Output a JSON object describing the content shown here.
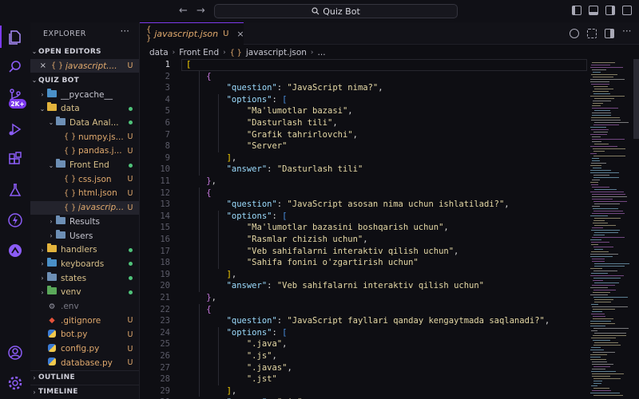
{
  "titlebar": {
    "search_text": "Quiz Bot"
  },
  "activity": {
    "badge": "2K+"
  },
  "sidebar": {
    "title": "EXPLORER",
    "open_editors_label": "OPEN EDITORS",
    "open_editor": {
      "name": "javascript....",
      "status": "U"
    },
    "project_label": "QUIZ BOT",
    "tree": [
      {
        "name": "__pycache__",
        "status": "",
        "type": "folder",
        "depth": 1,
        "state": "collapsed"
      },
      {
        "name": "data",
        "status": "dot",
        "type": "folder",
        "depth": 1,
        "state": "open"
      },
      {
        "name": "Data Anal...",
        "status": "dot",
        "type": "folder",
        "depth": 2,
        "state": "open"
      },
      {
        "name": "numpy.js...",
        "status": "U",
        "type": "json",
        "depth": 3
      },
      {
        "name": "pandas.j...",
        "status": "U",
        "type": "json",
        "depth": 3
      },
      {
        "name": "Front End",
        "status": "dot",
        "type": "folder",
        "depth": 2,
        "state": "open"
      },
      {
        "name": "css.json",
        "status": "U",
        "type": "json",
        "depth": 3
      },
      {
        "name": "html.json",
        "status": "U",
        "type": "json",
        "depth": 3
      },
      {
        "name": "javascrip...",
        "status": "U",
        "type": "json",
        "depth": 3,
        "active": true
      },
      {
        "name": "Results",
        "status": "",
        "type": "folder",
        "depth": 2,
        "state": "collapsed"
      },
      {
        "name": "Users",
        "status": "",
        "type": "folder",
        "depth": 2,
        "state": "collapsed"
      },
      {
        "name": "handlers",
        "status": "dot",
        "type": "folder",
        "depth": 1,
        "state": "collapsed"
      },
      {
        "name": "keyboards",
        "status": "dot",
        "type": "folder",
        "depth": 1,
        "state": "collapsed"
      },
      {
        "name": "states",
        "status": "dot",
        "type": "folder",
        "depth": 1,
        "state": "collapsed"
      },
      {
        "name": "venv",
        "status": "dot",
        "type": "folder",
        "depth": 1,
        "state": "collapsed"
      },
      {
        "name": ".env",
        "status": "",
        "type": "env",
        "depth": 1
      },
      {
        "name": ".gitignore",
        "status": "U",
        "type": "git",
        "depth": 1
      },
      {
        "name": "bot.py",
        "status": "U",
        "type": "py",
        "depth": 1
      },
      {
        "name": "config.py",
        "status": "U",
        "type": "py",
        "depth": 1
      },
      {
        "name": "database.py",
        "status": "U",
        "type": "py",
        "depth": 1
      }
    ],
    "outline_label": "OUTLINE",
    "timeline_label": "TIMELINE"
  },
  "editor": {
    "tab": {
      "name": "javascript.json",
      "status": "U",
      "close": "×"
    },
    "breadcrumb": [
      "data",
      "Front End",
      "javascript.json",
      "..."
    ],
    "lines": [
      "[",
      "    {",
      "        \"question\": \"JavaScript nima?\",",
      "        \"options\": [",
      "            \"Ma'lumotlar bazasi\",",
      "            \"Dasturlash tili\",",
      "            \"Grafik tahrirlovchi\",",
      "            \"Server\"",
      "        ],",
      "        \"answer\": \"Dasturlash tili\"",
      "    },",
      "    {",
      "        \"question\": \"JavaScript asosan nima uchun ishlatiladi?\",",
      "        \"options\": [",
      "            \"Ma'lumotlar bazasini boshqarish uchun\",",
      "            \"Rasmlar chizish uchun\",",
      "            \"Veb sahifalarni interaktiv qilish uchun\",",
      "            \"Sahifa fonini o'zgartirish uchun\"",
      "        ],",
      "        \"answer\": \"Veb sahifalarni interaktiv qilish uchun\"",
      "    },",
      "    {",
      "        \"question\": \"JavaScript fayllari qanday kengaytmada saqlanadi?\",",
      "        \"options\": [",
      "            \".java\",",
      "            \".js\",",
      "            \".javas\",",
      "            \".jst\"",
      "        ],",
      "        \"answer\": \".js\","
    ]
  },
  "colors": {
    "accent": "#7c3aed",
    "untracked": "#e0a96d",
    "modified_dot": "#4fc37a"
  }
}
